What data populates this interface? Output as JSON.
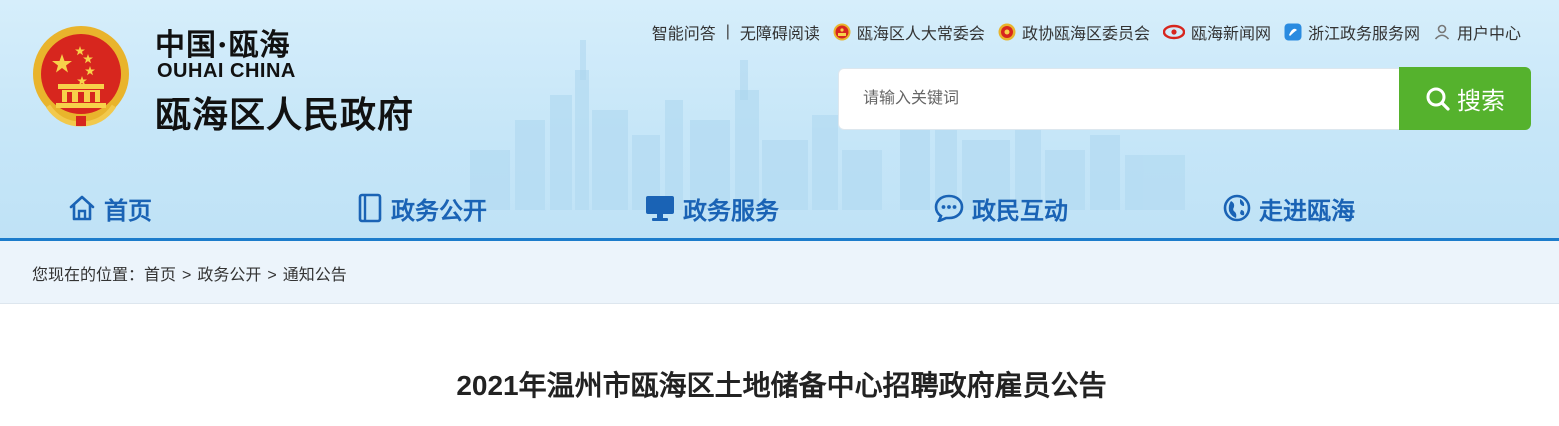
{
  "site": {
    "logo_cn": "中国·瓯海",
    "logo_en": "OUHAI CHINA",
    "name": "瓯海区人民政府"
  },
  "toplinks": [
    {
      "label": "智能问答",
      "icon": "none"
    },
    {
      "label": "无障碍阅读",
      "icon": "none"
    },
    {
      "label": "瓯海区人大常委会",
      "icon": "emblem-red-icon"
    },
    {
      "label": "政协瓯海区委员会",
      "icon": "cppcc-emblem-icon"
    },
    {
      "label": "瓯海新闻网",
      "icon": "news-logo-icon"
    },
    {
      "label": "浙江政务服务网",
      "icon": "zj-service-icon"
    },
    {
      "label": "用户中心",
      "icon": "user-icon"
    }
  ],
  "search": {
    "placeholder": "请输入关键词",
    "button_label": "搜索"
  },
  "nav": [
    {
      "label": "首页",
      "icon": "home-icon"
    },
    {
      "label": "政务公开",
      "icon": "document-icon"
    },
    {
      "label": "政务服务",
      "icon": "monitor-icon"
    },
    {
      "label": "政民互动",
      "icon": "chat-icon"
    },
    {
      "label": "走进瓯海",
      "icon": "globe-icon"
    }
  ],
  "breadcrumb": {
    "prefix": "您现在的位置：",
    "items": [
      "首页",
      "政务公开",
      "通知公告"
    ],
    "separator": ">"
  },
  "article": {
    "title": "2021年温州市瓯海区土地储备中心招聘政府雇员公告"
  },
  "colors": {
    "nav_blue": "#1a63b5",
    "search_green": "#55b22d",
    "accent_line": "#1c7ccb",
    "header_bg": "#c6e6f8"
  }
}
